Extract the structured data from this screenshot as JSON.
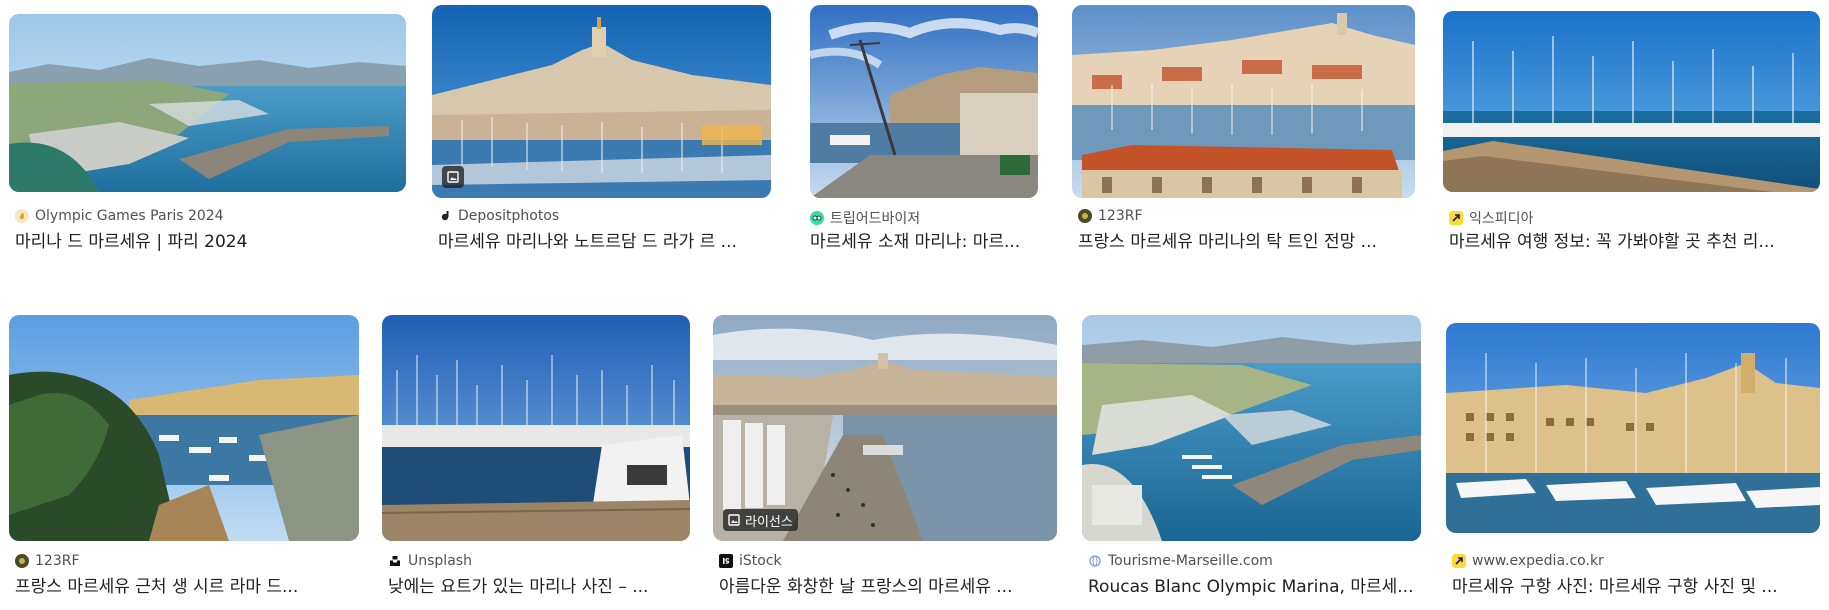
{
  "results": [
    {
      "source": "Olympic Games Paris 2024",
      "title": "마리나 드 마르세유 | 파리 2024",
      "favicon": "olympic-flame-icon",
      "favicon_color": "#e8c06a"
    },
    {
      "source": "Depositphotos",
      "title": "마르세유 마리나와 노트르담 드 라가 르 ...",
      "favicon": "depositphotos-icon",
      "favicon_color": "#222222"
    },
    {
      "source": "트립어드바이저",
      "title": "마르세유 소재 마리나: 마르...",
      "favicon": "tripadvisor-owl-icon",
      "favicon_color": "#34e0a1"
    },
    {
      "source": "123RF",
      "title": "프랑스 마르세유 마리나의 탁 트인 전망 ...",
      "favicon": "123rf-icon",
      "favicon_color": "#4a4a2a"
    },
    {
      "source": "익스피디아",
      "title": "마르세유 여행 정보: 꼭 가봐야할 곳 추천 리...",
      "favicon": "expedia-arrow-icon",
      "favicon_color": "#fddb32"
    },
    {
      "source": "123RF",
      "title": "프랑스 마르세유 근처 생 시르 라마 드...",
      "favicon": "123rf-icon",
      "favicon_color": "#4a4a2a"
    },
    {
      "source": "Unsplash",
      "title": "낮에는 요트가 있는 마리나 사진 – ...",
      "favicon": "unsplash-icon",
      "favicon_color": "#111111"
    },
    {
      "source": "iStock",
      "title": "아름다운 화창한 날 프랑스의 마르세유 ...",
      "favicon": "istock-icon",
      "favicon_color": "#111111"
    },
    {
      "source": "Tourisme-Marseille.com",
      "title": "Roucas Blanc Olympic Marina, 마르세...",
      "favicon": "globe-icon",
      "favicon_color": "#8a9bd6"
    },
    {
      "source": "www.expedia.co.kr",
      "title": "마르세유 구항 사진: 마르세유 구항 사진 및 ...",
      "favicon": "expedia-arrow-icon",
      "favicon_color": "#fddb32"
    }
  ],
  "badges": {
    "license_label": "라이선스"
  }
}
